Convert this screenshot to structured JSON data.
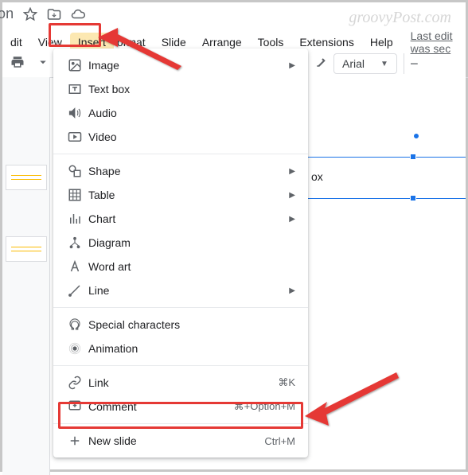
{
  "watermark": "groovyPost.com",
  "doc_title": "d presentation",
  "menubar": {
    "edit": "dit",
    "view": "View",
    "insert": "Insert",
    "format": "ormat",
    "slide": "Slide",
    "arrange": "Arrange",
    "tools": "Tools",
    "extensions": "Extensions",
    "help": "Help",
    "last_edit": "Last edit was sec"
  },
  "toolbar": {
    "font": "Arial"
  },
  "canvas": {
    "partial_text": "ox"
  },
  "menu": {
    "image": "Image",
    "textbox": "Text box",
    "audio": "Audio",
    "video": "Video",
    "shape": "Shape",
    "table": "Table",
    "chart": "Chart",
    "diagram": "Diagram",
    "wordart": "Word art",
    "line": "Line",
    "special": "Special characters",
    "animation": "Animation",
    "link": "Link",
    "link_shortcut": "⌘K",
    "comment": "Comment",
    "comment_shortcut": "⌘+Option+M",
    "newslide": "New slide",
    "newslide_shortcut": "Ctrl+M"
  }
}
